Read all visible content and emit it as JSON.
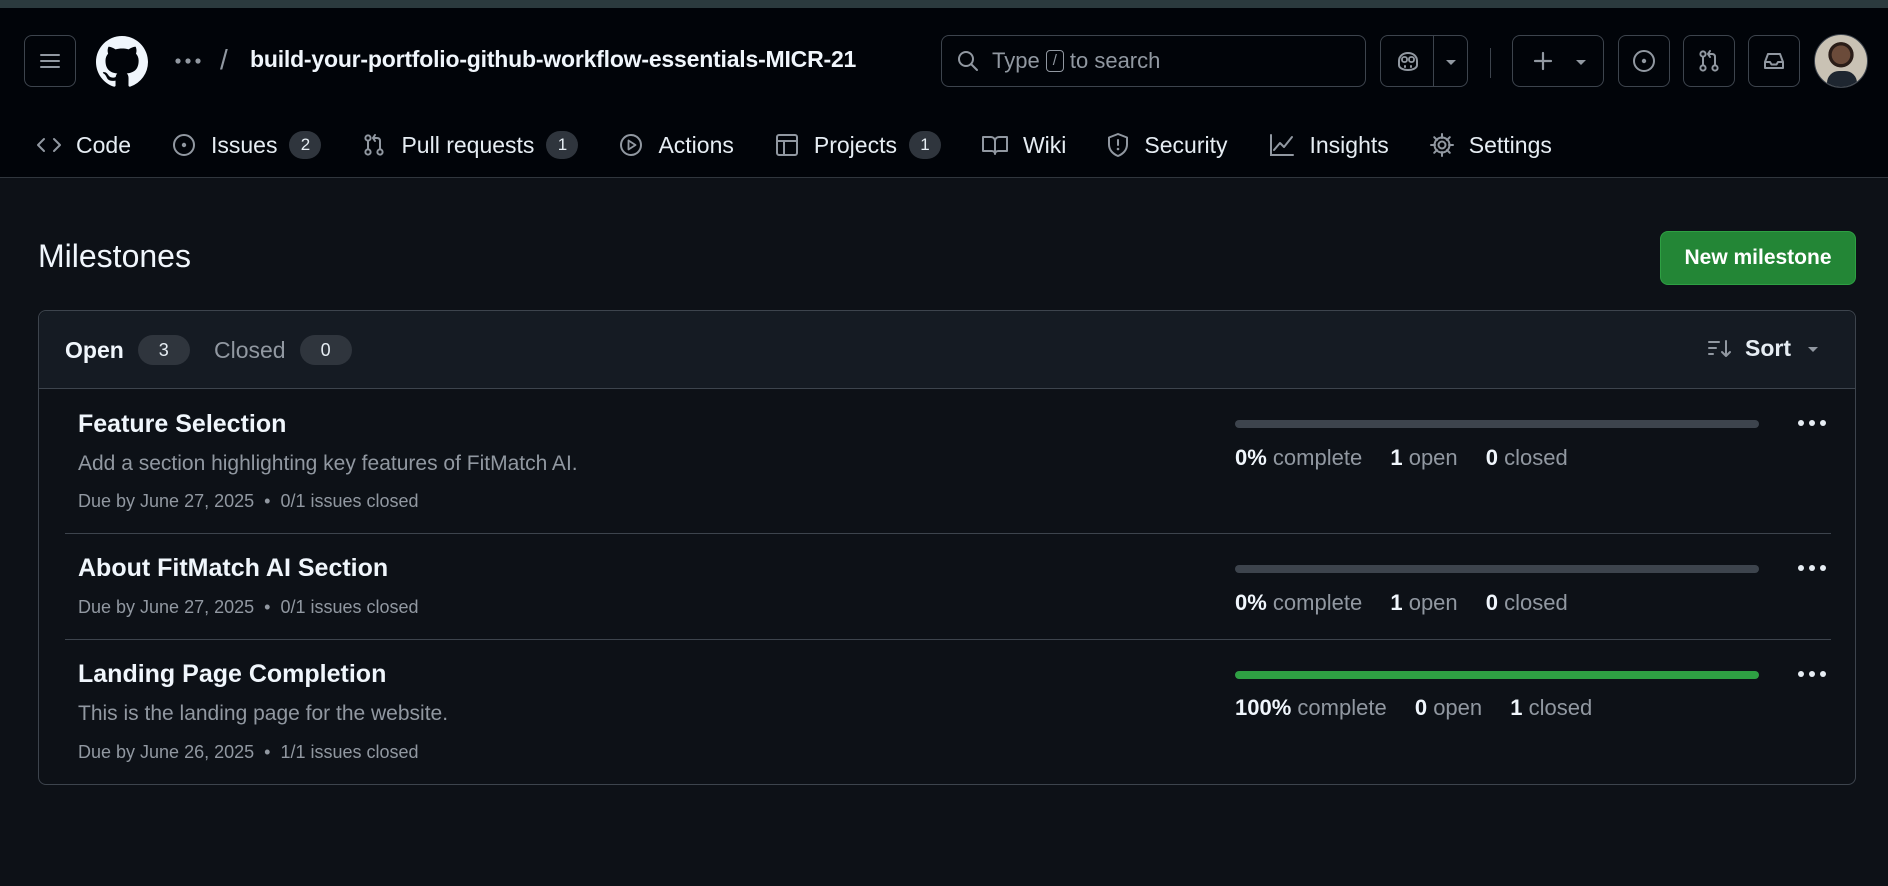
{
  "repo": {
    "name": "build-your-portfolio-github-workflow-essentials-MICR-21"
  },
  "search": {
    "prefix": "Type",
    "key": "/",
    "suffix": "to search"
  },
  "tabs": [
    {
      "label": "Code",
      "count": null
    },
    {
      "label": "Issues",
      "count": "2"
    },
    {
      "label": "Pull requests",
      "count": "1"
    },
    {
      "label": "Actions",
      "count": null
    },
    {
      "label": "Projects",
      "count": "1"
    },
    {
      "label": "Wiki",
      "count": null
    },
    {
      "label": "Security",
      "count": null
    },
    {
      "label": "Insights",
      "count": null
    },
    {
      "label": "Settings",
      "count": null
    }
  ],
  "page": {
    "title": "Milestones",
    "new_button": "New milestone"
  },
  "filters": {
    "open_label": "Open",
    "open_count": "3",
    "closed_label": "Closed",
    "closed_count": "0",
    "sort_label": "Sort"
  },
  "milestones": [
    {
      "title": "Feature Selection",
      "description": "Add a section highlighting key features of FitMatch AI.",
      "due": "Due by June 27, 2025",
      "issues": "0/1 issues closed",
      "progress": 0,
      "percent": "0%",
      "complete_label": "complete",
      "open_count": "1",
      "open_label": "open",
      "closed_count": "0",
      "closed_label": "closed"
    },
    {
      "title": "About FitMatch AI Section",
      "description": "",
      "due": "Due by June 27, 2025",
      "issues": "0/1 issues closed",
      "progress": 0,
      "percent": "0%",
      "complete_label": "complete",
      "open_count": "1",
      "open_label": "open",
      "closed_count": "0",
      "closed_label": "closed"
    },
    {
      "title": "Landing Page Completion",
      "description": "This is the landing page for the website.",
      "due": "Due by June 26, 2025",
      "issues": "1/1 issues closed",
      "progress": 100,
      "percent": "100%",
      "complete_label": "complete",
      "open_count": "0",
      "open_label": "open",
      "closed_count": "1",
      "closed_label": "closed"
    }
  ],
  "meta": {
    "bullet": "•"
  },
  "colors": {
    "accent_green": "#238636",
    "progress_green": "#2ea043",
    "bg": "#0d1117"
  }
}
